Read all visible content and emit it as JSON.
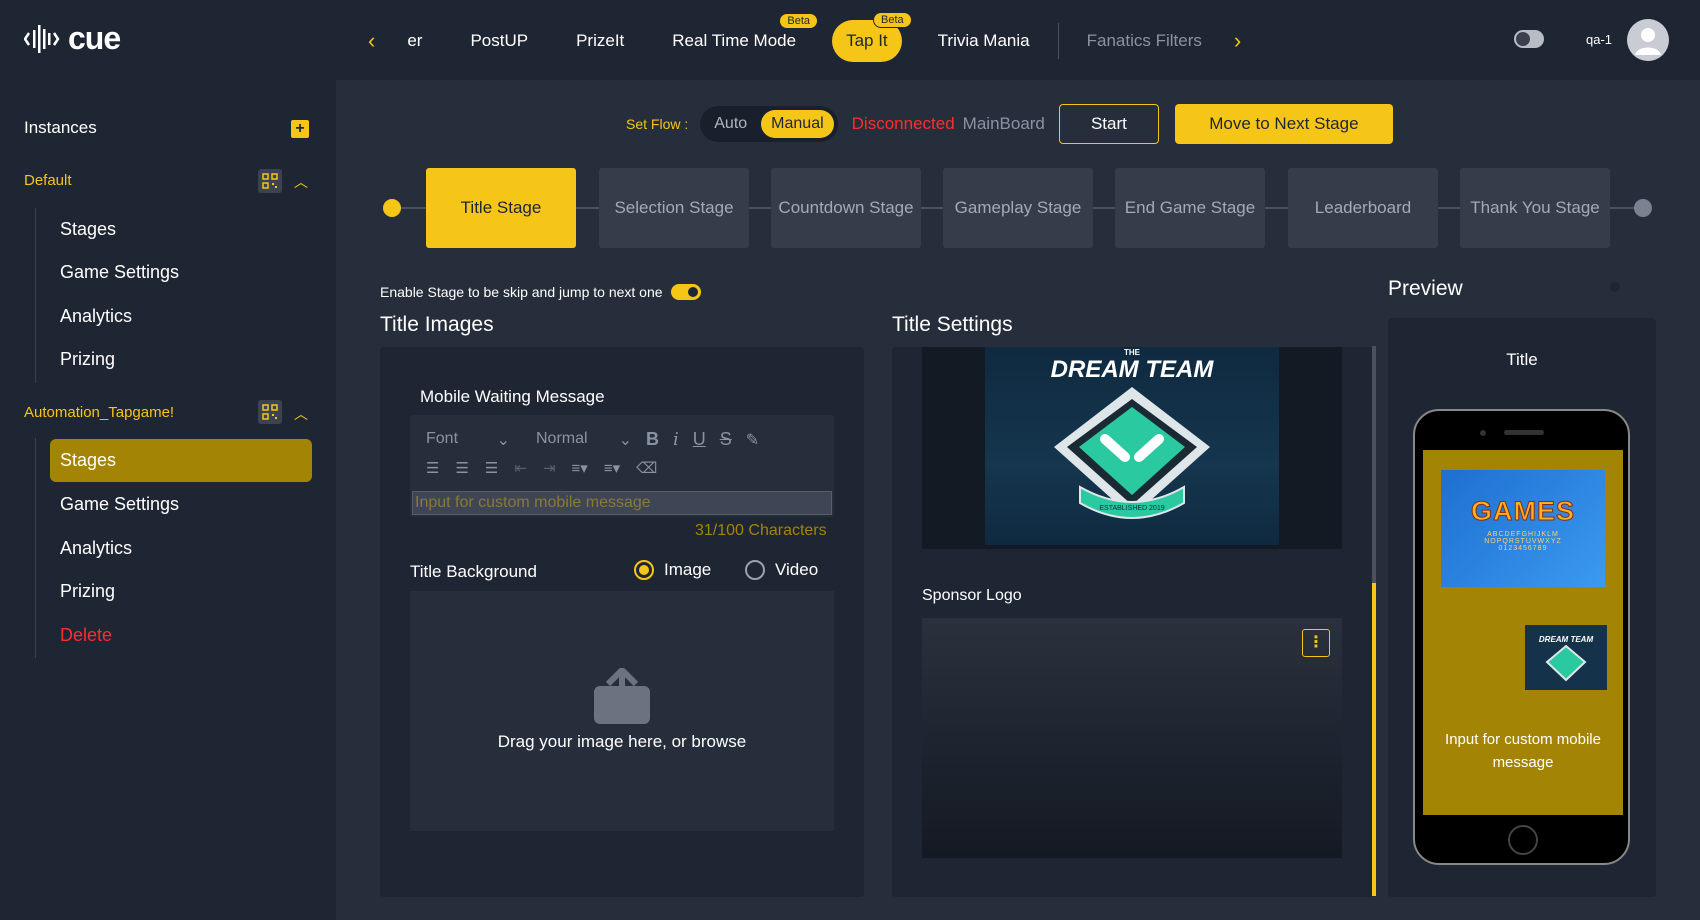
{
  "app": {
    "logo_text": "cue"
  },
  "tabs": [
    {
      "label": "er"
    },
    {
      "label": "PostUP"
    },
    {
      "label": "PrizeIt"
    },
    {
      "label": "Real Time Mode",
      "badge": "Beta"
    },
    {
      "label": "Tap It",
      "badge": "Beta",
      "active": true
    },
    {
      "label": "Trivia Mania"
    },
    {
      "label": "Fanatics Filters"
    }
  ],
  "user": {
    "name": "qa-1"
  },
  "sidebar": {
    "instances_label": "Instances",
    "groups": [
      {
        "title": "Default",
        "items": [
          "Stages",
          "Game Settings",
          "Analytics",
          "Prizing"
        ]
      },
      {
        "title": "Automation_Tapgame!",
        "items": [
          "Stages",
          "Game Settings",
          "Analytics",
          "Prizing",
          "Delete"
        ],
        "active_item": "Stages"
      }
    ]
  },
  "flow": {
    "label": "Set Flow :",
    "options": [
      "Auto",
      "Manual"
    ],
    "selected": "Manual",
    "status": "Disconnected",
    "board": "MainBoard",
    "start_label": "Start",
    "next_label": "Move to Next Stage"
  },
  "stages": [
    "Title Stage",
    "Selection Stage",
    "Countdown Stage",
    "Gameplay Stage",
    "End Game Stage",
    "Leaderboard",
    "Thank You Stage"
  ],
  "active_stage": "Title Stage",
  "skip_label": "Enable Stage to be skip and jump to next one",
  "title_images": {
    "heading": "Title Images",
    "mobile_msg_label": "Mobile Waiting Message",
    "font_placeholder": "Font",
    "size_placeholder": "Normal",
    "input_placeholder": "Input for custom mobile message",
    "char_count": "31/100 Characters",
    "background_label": "Title Background",
    "bg_options": [
      "Image",
      "Video"
    ],
    "bg_selected": "Image",
    "drop_text": "Drag your image here, or browse"
  },
  "title_settings": {
    "heading": "Title Settings",
    "sponsor_label": "Sponsor Logo",
    "logo_text": "DREAM TEAM",
    "logo_top": "THE",
    "logo_sub": "ESTABLISHED 2019"
  },
  "preview": {
    "heading": "Preview",
    "screen_title": "Title",
    "games_text": "GAMES",
    "games_letters1": "ABCDEFGHIJKLM",
    "games_letters2": "NOPQRSTUVWXYZ",
    "games_digits": "0123456789",
    "mini_logo_text": "DREAM TEAM",
    "message": "Input for custom mobile message"
  }
}
